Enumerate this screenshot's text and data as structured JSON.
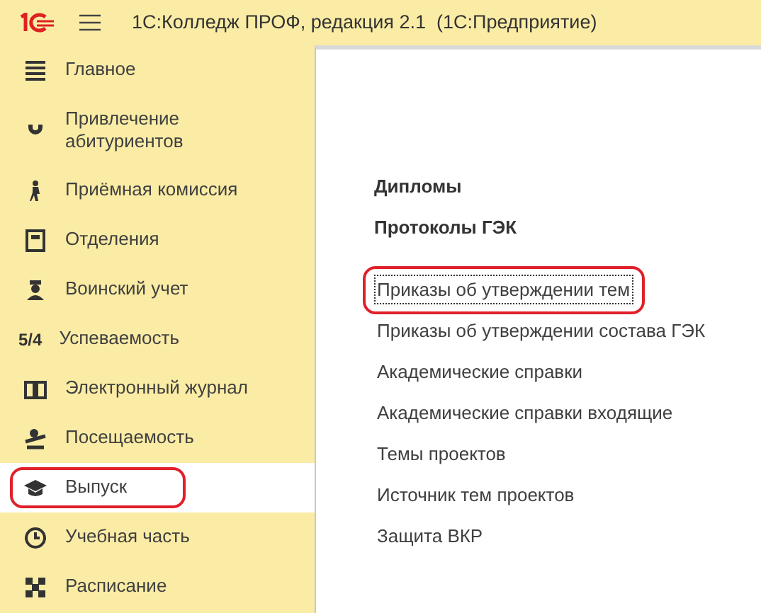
{
  "window": {
    "title": "1С:Колледж ПРОФ, редакция 2.1  (1С:Предприятие)"
  },
  "sidebar": {
    "items": [
      {
        "label": "Главное",
        "selected": false,
        "highlighted": false
      },
      {
        "label": "Привлечение абитуриентов",
        "selected": false,
        "highlighted": false
      },
      {
        "label": "Приёмная комиссия",
        "selected": false,
        "highlighted": false
      },
      {
        "label": "Отделения",
        "selected": false,
        "highlighted": false
      },
      {
        "label": "Воинский учет",
        "selected": false,
        "highlighted": false
      },
      {
        "label": "Успеваемость",
        "icon_text": "5/4",
        "selected": false,
        "highlighted": false
      },
      {
        "label": "Электронный журнал",
        "selected": false,
        "highlighted": false
      },
      {
        "label": "Посещаемость",
        "selected": false,
        "highlighted": false
      },
      {
        "label": "Выпуск",
        "selected": true,
        "highlighted": true
      },
      {
        "label": "Учебная часть",
        "selected": false,
        "highlighted": false
      },
      {
        "label": "Расписание",
        "selected": false,
        "highlighted": false
      }
    ]
  },
  "content": {
    "headings": [
      "Дипломы",
      "Протоколы ГЭК"
    ],
    "links": [
      {
        "label": "Приказы об утверждении тем",
        "focused": true,
        "highlighted": true
      },
      {
        "label": "Приказы об утверждении состава ГЭК",
        "focused": false,
        "highlighted": false
      },
      {
        "label": "Академические справки",
        "focused": false,
        "highlighted": false
      },
      {
        "label": "Академические справки входящие",
        "focused": false,
        "highlighted": false
      },
      {
        "label": "Темы проектов",
        "focused": false,
        "highlighted": false
      },
      {
        "label": "Источник тем проектов",
        "focused": false,
        "highlighted": false
      },
      {
        "label": "Защита ВКР",
        "focused": false,
        "highlighted": false
      }
    ]
  }
}
